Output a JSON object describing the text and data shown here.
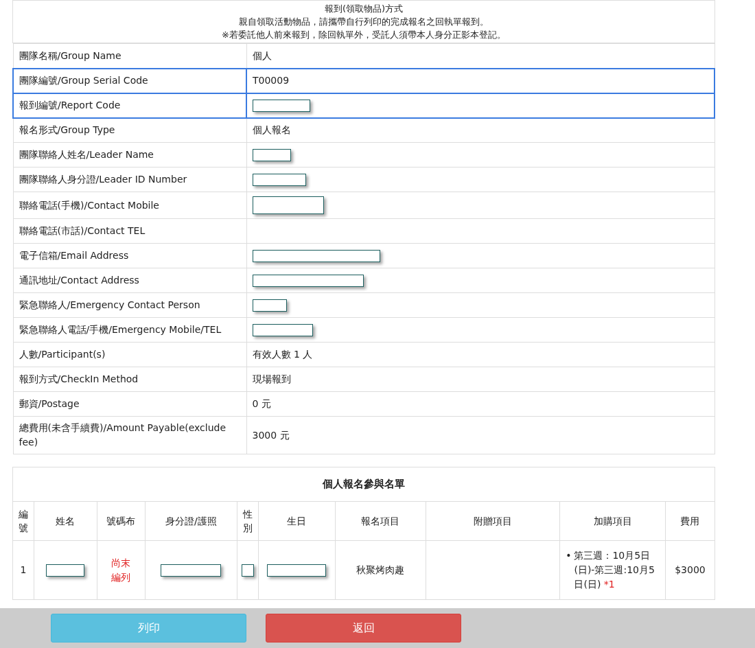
{
  "notice": {
    "title": "報到(領取物品)方式",
    "lines": [
      "親自領取活動物品，請攜帶自行列印的完成報名之回執單報到。",
      "※若委託他人前來報到，除回執單外，受託人須帶本人身分正影本登記。"
    ]
  },
  "fields": [
    {
      "label": "團隊名稱/Group Name",
      "kind": "text",
      "value": "個人",
      "highlighted": false
    },
    {
      "label": "團隊編號/Group Serial Code",
      "kind": "text",
      "value": "T00009",
      "highlighted": true
    },
    {
      "label": "報到編號/Report Code",
      "kind": "input",
      "highlighted": true
    },
    {
      "label": "報名形式/Group Type",
      "kind": "text",
      "value": "個人報名",
      "highlighted": false
    },
    {
      "label": "團隊聯絡人姓名/Leader Name",
      "kind": "input",
      "highlighted": false
    },
    {
      "label": "團隊聯絡人身分證/Leader ID Number",
      "kind": "input",
      "highlighted": false
    },
    {
      "label": "聯絡電話(手機)/Contact Mobile",
      "kind": "input",
      "highlighted": false
    },
    {
      "label": "聯絡電話(市話)/Contact TEL",
      "kind": "empty",
      "highlighted": false
    },
    {
      "label": "電子信箱/Email Address",
      "kind": "input",
      "highlighted": false
    },
    {
      "label": "通訊地址/Contact Address",
      "kind": "input",
      "highlighted": false
    },
    {
      "label": "緊急聯絡人/Emergency Contact Person",
      "kind": "input",
      "highlighted": false
    },
    {
      "label": "緊急聯絡人電話/手機/Emergency Mobile/TEL",
      "kind": "input",
      "highlighted": false
    },
    {
      "label": "人數/Participant(s)",
      "kind": "text",
      "value": "有效人數 1 人",
      "highlighted": false
    },
    {
      "label": "報到方式/CheckIn Method",
      "kind": "text",
      "value": "現場報到",
      "highlighted": false
    },
    {
      "label": "郵資/Postage",
      "kind": "text",
      "value": "0 元",
      "highlighted": false
    },
    {
      "label": "總費用(未含手續費)/Amount Payable(exclude fee)",
      "kind": "text",
      "value": "3000 元",
      "highlighted": false
    }
  ],
  "participants": {
    "title": "個人報名參與名單",
    "columns": [
      "編號",
      "姓名",
      "號碼布",
      "身分證/護照",
      "性別",
      "生日",
      "報名項目",
      "附贈項目",
      "加購項目",
      "費用"
    ],
    "rows": [
      {
        "no": "1",
        "bib": "尚末編列",
        "gender_checked": false,
        "bullet": "•",
        "event": "秋聚烤肉趣",
        "addon": "第三週：10月5日(日)-第三週:10月5日(日)",
        "addon_qty": "*1",
        "fee": "$3000"
      }
    ]
  },
  "buttons": [
    {
      "label": "列印",
      "kind": "print"
    },
    {
      "label": "返回",
      "kind": "back"
    }
  ]
}
